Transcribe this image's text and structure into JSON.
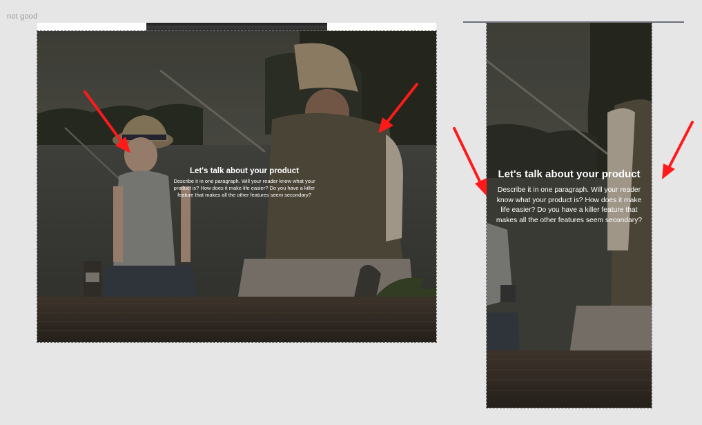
{
  "page": {
    "label": "not good"
  },
  "hero": {
    "title": "Let's talk about your product",
    "body": "Describe it in one paragraph. Will your reader know what your product is? How does it make life easier? Do you have a killer feature that makes all the other features seem secondary?"
  },
  "annotations": {
    "arrow_color": "#ff1a1a",
    "count": 4
  },
  "colors": {
    "canvas_background": "#e6e6e6",
    "hero_text": "#ffffff",
    "frame_outline": "#777777"
  },
  "icons": [
    "red-arrow-annotation"
  ]
}
